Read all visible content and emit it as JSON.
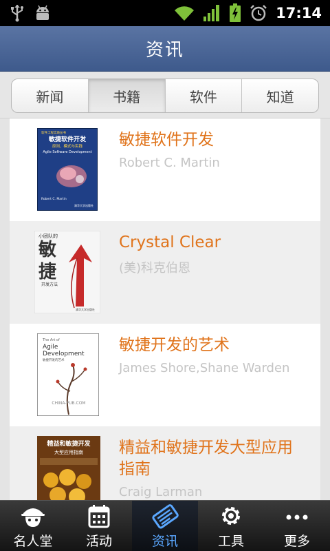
{
  "status_bar": {
    "time": "17:14"
  },
  "header": {
    "title": "资讯"
  },
  "tabs": [
    {
      "label": "新闻",
      "active": false
    },
    {
      "label": "书籍",
      "active": true
    },
    {
      "label": "软件",
      "active": false
    },
    {
      "label": "知道",
      "active": false
    }
  ],
  "books": [
    {
      "title": "敏捷软件开发",
      "author": "Robert C. Martin",
      "cover": {
        "series": "软件工程实践丛书",
        "main": "敏捷软件开发",
        "sub": "原则、模式与实践",
        "en": "Agile Software Development",
        "author": "Robert C. Martin",
        "publisher": "清华大学出版社"
      }
    },
    {
      "title": "Crystal Clear",
      "author": "(美)科克伯恩",
      "cover": {
        "top": "小团队的",
        "main1": "敏",
        "main2": "捷",
        "sub": "开发方法",
        "publisher": "清华大学出版社"
      }
    },
    {
      "title": "敏捷开发的艺术",
      "author": "James Shore,Shane Warden",
      "cover": {
        "top": "The Art of",
        "main1": "Agile",
        "main2": "Development",
        "sub": "敏捷开发的艺术",
        "watermark": "CHINA-PUB.COM"
      }
    },
    {
      "title": "精益和敏捷开发大型应用指南",
      "author": "Craig Larman",
      "cover": {
        "main": "精益和敏捷开发",
        "sub": "大型应用指南"
      }
    }
  ],
  "bottom_nav": [
    {
      "label": "名人堂",
      "icon": "famous-people-icon",
      "active": false
    },
    {
      "label": "活动",
      "icon": "calendar-icon",
      "active": false
    },
    {
      "label": "资讯",
      "icon": "news-icon",
      "active": true
    },
    {
      "label": "工具",
      "icon": "gear-icon",
      "active": false
    },
    {
      "label": "更多",
      "icon": "more-icon",
      "active": false
    }
  ]
}
